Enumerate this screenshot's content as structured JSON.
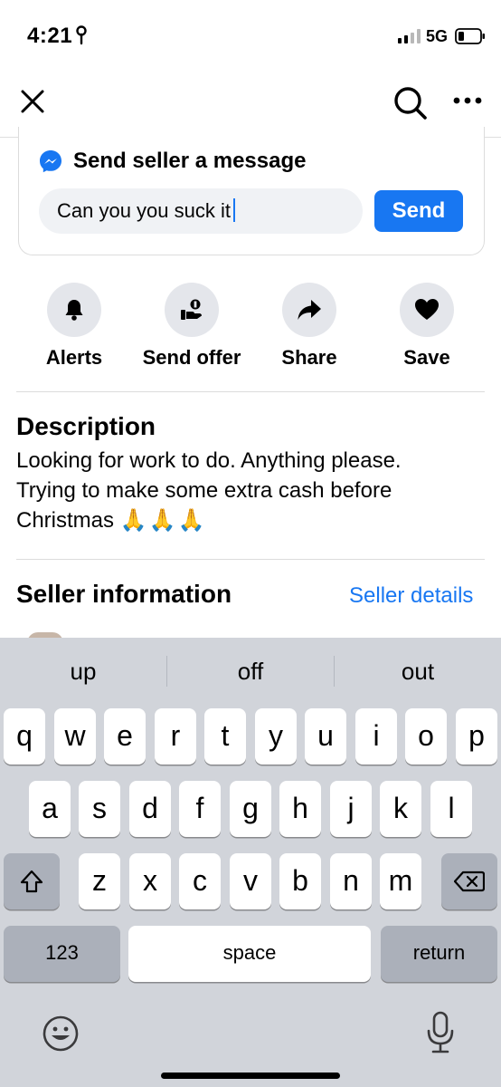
{
  "status_bar": {
    "time": "4:21",
    "network": "5G",
    "icons": [
      "location-icon",
      "signal-icon",
      "battery-icon"
    ]
  },
  "nav": {
    "icons": [
      "close-icon",
      "search-icon",
      "more-icon"
    ]
  },
  "message_card": {
    "title": "Send seller a message",
    "input_value": "Can you you suck it",
    "send_label": "Send",
    "accent_color": "#1877f2"
  },
  "actions": [
    {
      "label": "Alerts",
      "icon": "bell-icon"
    },
    {
      "label": "Send offer",
      "icon": "offer-icon"
    },
    {
      "label": "Share",
      "icon": "share-icon"
    },
    {
      "label": "Save",
      "icon": "heart-icon"
    }
  ],
  "description": {
    "heading": "Description",
    "line1": "Looking for work to do. Anything please.",
    "line2": "Trying to make some extra cash before",
    "line3": "Christmas",
    "emoji": "🙏🙏🙏"
  },
  "seller": {
    "heading": "Seller information",
    "link": "Seller details"
  },
  "keyboard": {
    "suggestions": [
      "up",
      "off",
      "out"
    ],
    "row1": [
      "q",
      "w",
      "e",
      "r",
      "t",
      "y",
      "u",
      "i",
      "o",
      "p"
    ],
    "row2": [
      "a",
      "s",
      "d",
      "f",
      "g",
      "h",
      "j",
      "k",
      "l"
    ],
    "row3": [
      "z",
      "x",
      "c",
      "v",
      "b",
      "n",
      "m"
    ],
    "numbers_label": "123",
    "space_label": "space",
    "return_label": "return",
    "icons": [
      "shift-icon",
      "delete-icon",
      "emoji-icon",
      "microphone-icon"
    ]
  }
}
